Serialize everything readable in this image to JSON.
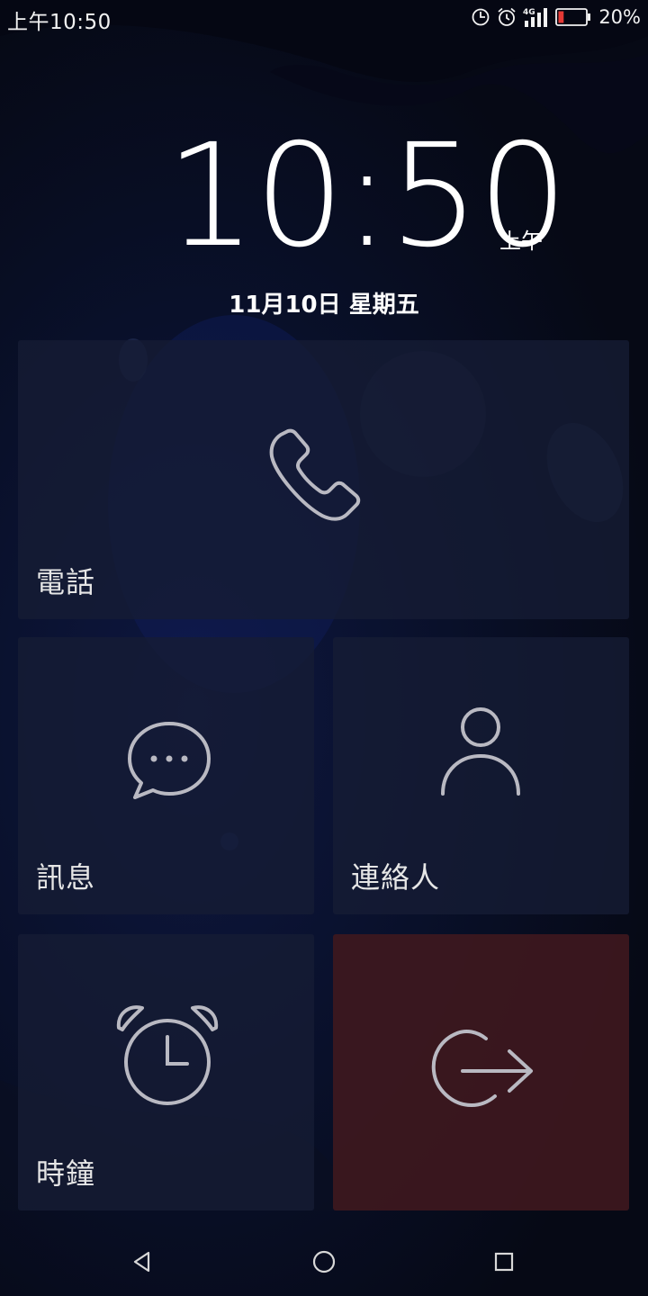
{
  "status_bar": {
    "time": "上午10:50",
    "network": "4G",
    "battery_percent": "20%",
    "battery_level": 0.2,
    "icons": [
      "data-saver-icon",
      "alarm-icon",
      "signal-4g-icon",
      "battery-low-icon"
    ]
  },
  "lock_clock": {
    "time": "10:50",
    "ampm": "上午",
    "date": "11月10日 星期五"
  },
  "tiles": {
    "phone": {
      "label": "電話",
      "icon": "phone-icon"
    },
    "messages": {
      "label": "訊息",
      "icon": "chat-bubble-icon"
    },
    "contacts": {
      "label": "連絡人",
      "icon": "person-icon"
    },
    "clock": {
      "label": "時鐘",
      "icon": "alarm-clock-icon"
    },
    "exit": {
      "icon": "exit-icon",
      "color": "#3e181e"
    }
  },
  "navigation": {
    "icons": [
      "back-icon",
      "home-icon",
      "recents-icon"
    ]
  },
  "colors": {
    "tile": "#161c34",
    "tile_icon": "#b9b9c2",
    "background": "#070a16"
  }
}
